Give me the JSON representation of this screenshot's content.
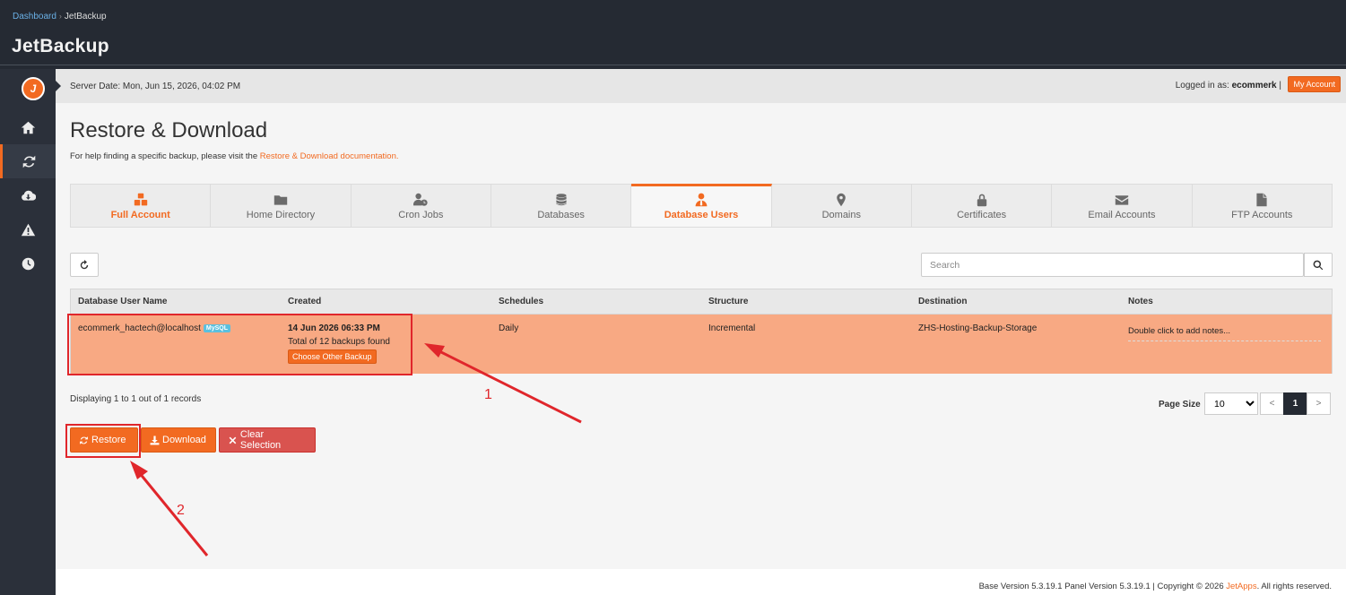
{
  "breadcrumb": {
    "home": "Dashboard",
    "current": "JetBackup"
  },
  "app_title": "JetBackup",
  "logo_letter": "J",
  "server_bar": {
    "server_date": "Server Date: Mon, Jun 15, 2026, 04:02 PM",
    "logged_in_label": "Logged in as:",
    "username": "ecommerk",
    "separator": "|",
    "my_account": "My Account"
  },
  "page": {
    "title": "Restore & Download",
    "help_prefix": "For help finding a specific backup, please visit the",
    "help_link": "Restore & Download documentation."
  },
  "tabs": [
    {
      "label": "Full Account",
      "icon": "cubes-icon"
    },
    {
      "label": "Home Directory",
      "icon": "folder-icon"
    },
    {
      "label": "Cron Jobs",
      "icon": "user-clock-icon"
    },
    {
      "label": "Databases",
      "icon": "database-icon"
    },
    {
      "label": "Database Users",
      "icon": "user-tie-icon"
    },
    {
      "label": "Domains",
      "icon": "map-marker-icon"
    },
    {
      "label": "Certificates",
      "icon": "lock-icon"
    },
    {
      "label": "Email Accounts",
      "icon": "envelope-icon"
    },
    {
      "label": "FTP Accounts",
      "icon": "file-icon"
    }
  ],
  "search": {
    "placeholder": "Search"
  },
  "table": {
    "headers": [
      "Database User Name",
      "Created",
      "Schedules",
      "Structure",
      "Destination",
      "Notes"
    ],
    "rows": [
      {
        "name": "ecommerk_hactech@localhost",
        "badge": "MySQL",
        "created": "14 Jun 2026 06:33 PM",
        "total": "Total of 12 backups found",
        "choose": "Choose Other Backup",
        "schedule": "Daily",
        "structure": "Incremental",
        "destination": "ZHS-Hosting-Backup-Storage",
        "notes": "Double click to add notes..."
      }
    ]
  },
  "pagination": {
    "display": "Displaying 1 to 1 out of 1 records",
    "page_size_label": "Page Size",
    "page_size": "10",
    "prev": "<",
    "current": "1",
    "next": ">"
  },
  "actions": {
    "restore": "Restore",
    "download": "Download",
    "clear": "Clear Selection"
  },
  "annotations": {
    "one": "1",
    "two": "2"
  },
  "footer": {
    "text": "Base Version 5.3.19.1 Panel Version 5.3.19.1 | Copyright © 2026",
    "brand": "JetApps",
    "suffix": ". All rights reserved."
  },
  "colors": {
    "accent": "#f26a21",
    "selected_row": "#f8a983",
    "danger": "#d9534f",
    "dark": "#252a33"
  }
}
